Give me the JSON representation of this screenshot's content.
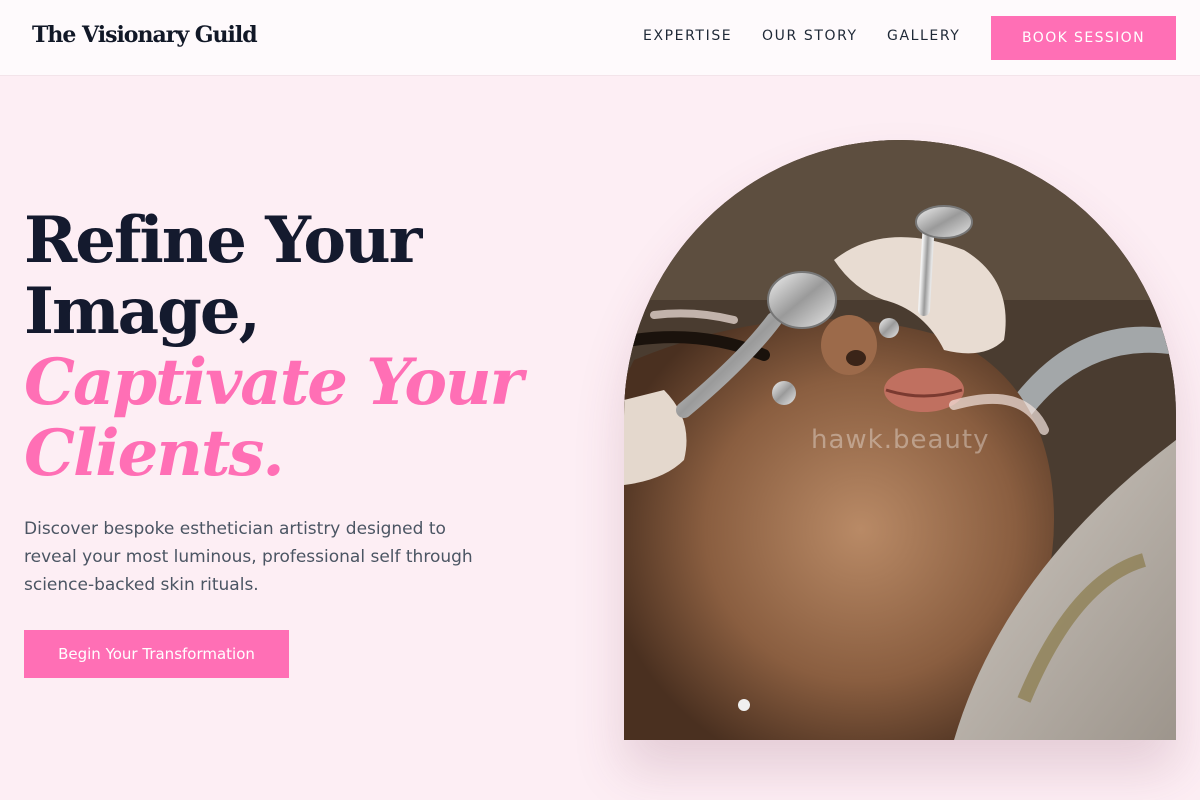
{
  "header": {
    "logo": "The Visionary Guild",
    "nav": [
      "EXPERTISE",
      "OUR STORY",
      "GALLERY"
    ],
    "cta": "BOOK SESSION"
  },
  "hero": {
    "headline_dark": [
      "Refine Your",
      "Image,"
    ],
    "headline_accent": [
      "Captivate Your",
      "Clients."
    ],
    "description": "Discover bespoke esthetician artistry designed to reveal your most luminous, professional self through science-backed skin rituals.",
    "cta": "Begin Your Transformation",
    "image": {
      "subject": "esthetician-treatment-photo",
      "watermark": "hawk.beauty"
    }
  },
  "colors": {
    "accent": "#ff6fb5",
    "page_background": "#fdeef4",
    "header_background": "#fefafc",
    "headline_dark": "#141a2e",
    "body_text": "#4b5563"
  }
}
